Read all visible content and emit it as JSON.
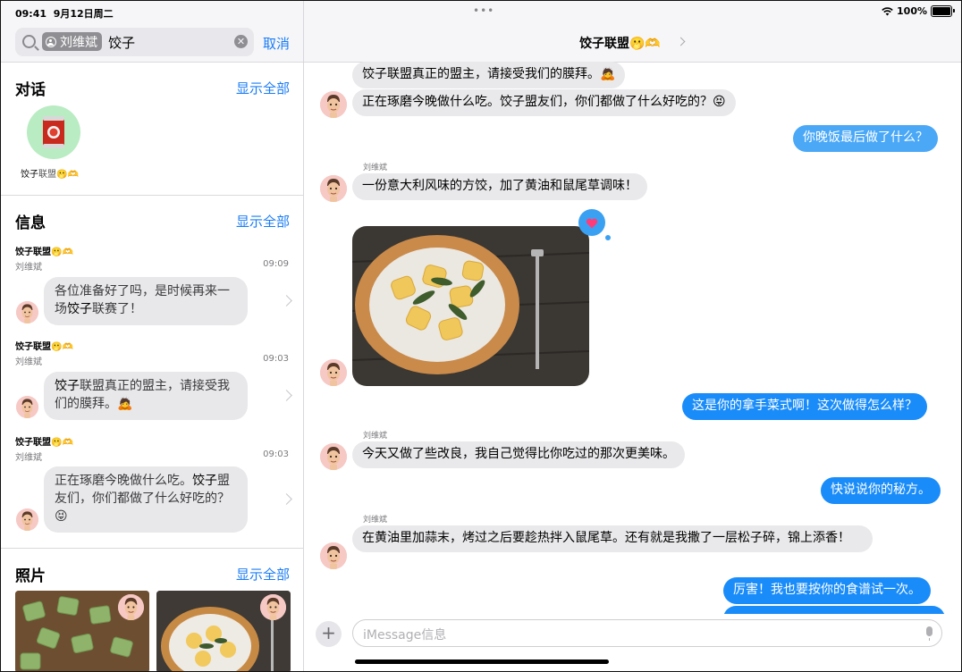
{
  "status": {
    "time": "09:41",
    "date": "9月12日周二",
    "battery": "100%"
  },
  "search": {
    "token": "刘维斌",
    "query": "饺子",
    "cancel": "取消"
  },
  "conversations": {
    "title": "对话",
    "show_all": "显示全部",
    "item": {
      "name_part1": "饺子",
      "name_part2": "联盟",
      "emoji": "🫢🫶"
    }
  },
  "messages": {
    "title": "信息",
    "show_all": "显示全部",
    "items": [
      {
        "group": "饺子联盟🫢🫶",
        "sender": "刘维斌",
        "time": "09:09",
        "pre": "各位准备好了吗，是时候再来一场",
        "hit": "饺子",
        "post": "联赛了！"
      },
      {
        "group": "饺子联盟🫢🫶",
        "sender": "刘维斌",
        "time": "09:03",
        "pre": "",
        "hit": "饺子",
        "post": "联盟真正的盟主，请接受我们的膜拜。🙇"
      },
      {
        "group": "饺子联盟🫢🫶",
        "sender": "刘维斌",
        "time": "09:03",
        "pre": "正在琢磨今晚做什么吃。",
        "hit": "饺子",
        "post": "盟友们，你们都做了什么好吃的？😝"
      }
    ]
  },
  "photos": {
    "title": "照片",
    "show_all": "显示全部"
  },
  "chat": {
    "title": "饺子联盟🫢🫶",
    "messages": [
      "饺子联盟真正的盟主，请接受我们的膜拜。🙇",
      "正在琢磨今晚做什么吃。饺子盟友们，你们都做了什么好吃的？😝",
      "你晚饭最后做了什么？",
      "一份意大利风味的方饺，加了黄油和鼠尾草调味！",
      "这是你的拿手菜式啊！这次做得怎么样？",
      "今天又做了些改良，我自己觉得比你吃过的那次更美味。",
      "快说说你的秘方。",
      "在黄油里加蒜末，烤过之后要趁热拌入鼠尾草。还有就是我撒了一层松子碎，锦上添香！",
      "厉害！我也要按你的食谱试一次。"
    ],
    "sender_label": "刘维斌",
    "input_placeholder": "iMessage信息"
  }
}
